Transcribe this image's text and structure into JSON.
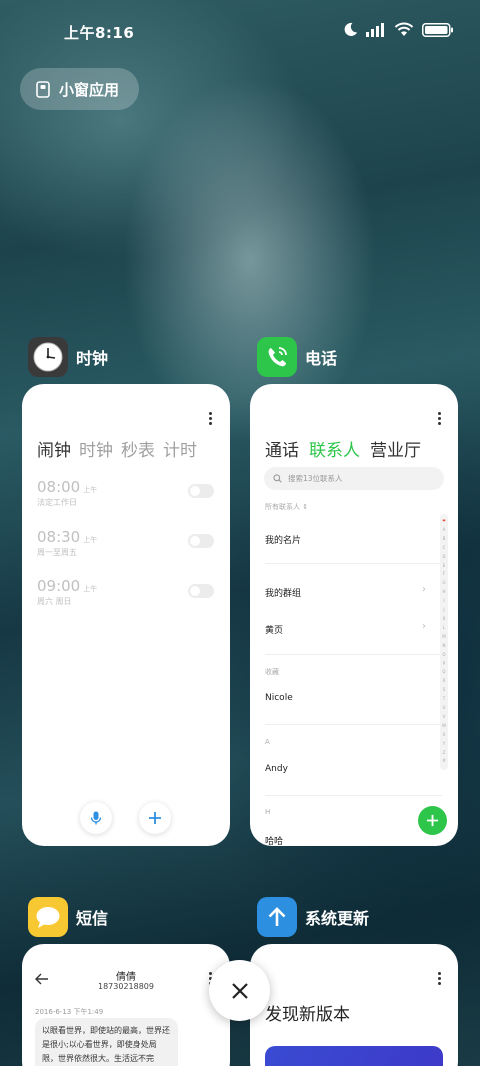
{
  "status_bar": {
    "time": "上午8:16"
  },
  "small_window": {
    "label": "小窗应用"
  },
  "apps": {
    "clock": {
      "name": "时钟",
      "tabs": [
        "闹钟",
        "时钟",
        "秒表",
        "计时"
      ],
      "alarms": [
        {
          "time": "08:00",
          "ampm": "上午",
          "repeat": "法定工作日"
        },
        {
          "time": "08:30",
          "ampm": "上午",
          "repeat": "周一至周五"
        },
        {
          "time": "09:00",
          "ampm": "上午",
          "repeat": "周六 周日"
        }
      ]
    },
    "phone": {
      "name": "电话",
      "tabs": [
        "通话",
        "联系人",
        "营业厅"
      ],
      "search_placeholder": "搜索13位联系人",
      "filter": "所有联系人 ⇕",
      "my_card": "我的名片",
      "my_groups": "我的群组",
      "yellow_pages": "黄页",
      "favorites_label": "收藏",
      "contacts": [
        {
          "section": "",
          "name": "Nicole"
        },
        {
          "section": "A",
          "name": "Andy"
        },
        {
          "section": "H",
          "name": "哈哈"
        }
      ],
      "index_letters": [
        "❤",
        "A",
        "B",
        "C",
        "D",
        "E",
        "F",
        "G",
        "H",
        "I",
        "J",
        "K",
        "L",
        "M",
        "N",
        "O",
        "P",
        "Q",
        "R",
        "S",
        "T",
        "U",
        "V",
        "W",
        "X",
        "Y",
        "Z",
        "#"
      ]
    },
    "sms": {
      "name": "短信",
      "contact": "倩倩",
      "number": "18730218809",
      "date": "2016-6-13 下午1:49",
      "message": "以眼看世界，即使站的最高，世界还是很小;以心看世界，即使身处局限，世界依然很大。生活远不完"
    },
    "update": {
      "name": "系统更新",
      "title": "发现新版本"
    }
  },
  "colors": {
    "accent_green": "#2ec54b",
    "blue_icon": "#2d8fe0",
    "sms_yellow": "#f8c832"
  }
}
